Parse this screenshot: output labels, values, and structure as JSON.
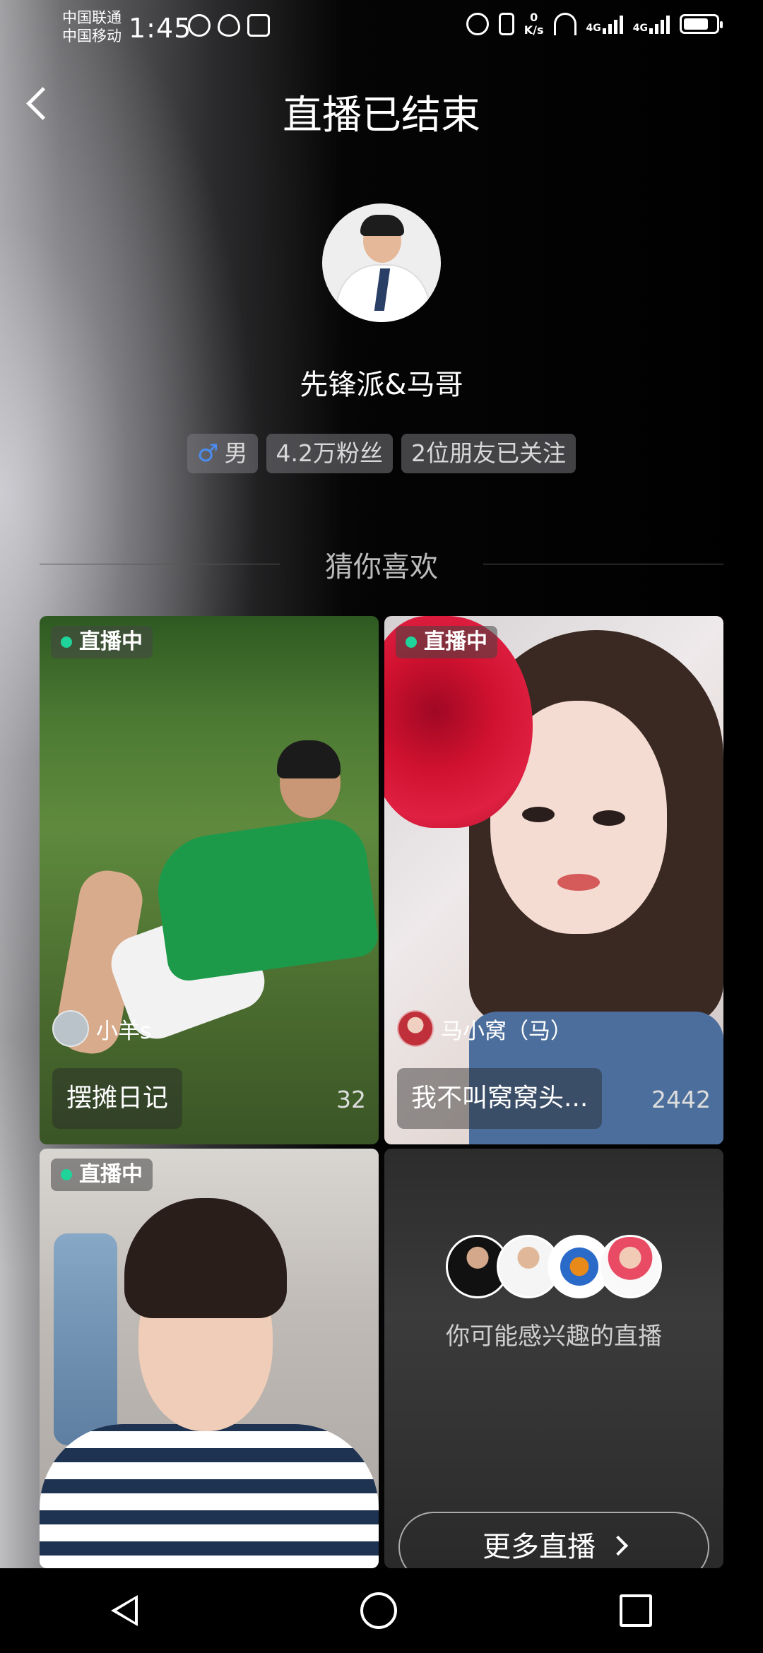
{
  "status": {
    "carrier1": "中国联通",
    "carrier2": "中国移动",
    "time": "1:45",
    "speed_value": "0",
    "speed_unit": "K/s",
    "net1": "4G",
    "net2": "4G"
  },
  "header": {
    "title": "直播已结束"
  },
  "profile": {
    "name": "先锋派&马哥",
    "gender_symbol": "♂",
    "gender": "男",
    "fans": "4.2万粉丝",
    "friends": "2位朋友已关注"
  },
  "section": {
    "title": "猜你喜欢"
  },
  "cards": [
    {
      "live_label": "直播中",
      "host": "小羊s",
      "caption": "摆摊日记",
      "count": "32"
    },
    {
      "live_label": "直播中",
      "host": "马小窝（马）",
      "caption": "我不叫窝窝头...",
      "count": "2442"
    },
    {
      "live_label": "直播中"
    }
  ],
  "more": {
    "text": "你可能感兴趣的直播",
    "button": "更多直播"
  },
  "colors": {
    "live_dot": "#1fd39a",
    "male_icon": "#4a8cf0"
  }
}
